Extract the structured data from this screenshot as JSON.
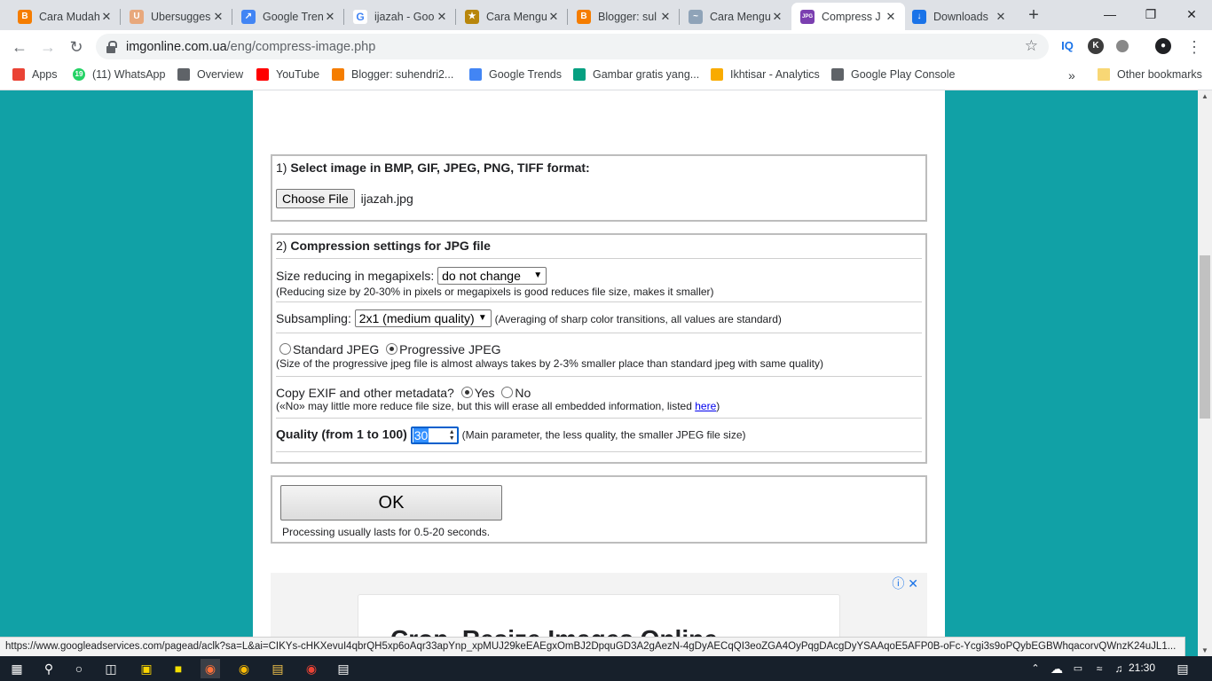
{
  "browser": {
    "tabs": [
      {
        "title": "Cara Mudah",
        "fav_color": "#f57d00",
        "fav_glyph": "B"
      },
      {
        "title": "Ubersugges",
        "fav_color": "#e8a87c",
        "fav_glyph": "U"
      },
      {
        "title": "Google Tren",
        "fav_color": "#4285f4",
        "fav_glyph": "↗"
      },
      {
        "title": "ijazah - Goo",
        "fav_color": "#ffffff",
        "fav_glyph": "G"
      },
      {
        "title": "Cara Mengu",
        "fav_color": "#b8860b",
        "fav_glyph": "★"
      },
      {
        "title": "Blogger: sul",
        "fav_color": "#f57d00",
        "fav_glyph": "B"
      },
      {
        "title": "Cara Mengu",
        "fav_color": "#8fa3b8",
        "fav_glyph": "~"
      },
      {
        "title": "Compress J",
        "fav_color": "#7b3fb0",
        "fav_glyph": "JPG",
        "active": true
      },
      {
        "title": "Downloads",
        "fav_color": "#1a73e8",
        "fav_glyph": "↓"
      }
    ],
    "url_domain": "imgonline.com.ua",
    "url_path": "/eng/compress-image.php",
    "bookmarks": [
      {
        "label": "Apps",
        "color": "#ea4335"
      },
      {
        "label": "(11) WhatsApp",
        "color": "#25d366",
        "glyph": "19"
      },
      {
        "label": "Overview",
        "color": "#5f6368"
      },
      {
        "label": "YouTube",
        "color": "#ff0000"
      },
      {
        "label": "Blogger: suhendri2...",
        "color": "#f57d00"
      },
      {
        "label": "Google Trends",
        "color": "#4285f4"
      },
      {
        "label": "Gambar gratis yang...",
        "color": "#05a081"
      },
      {
        "label": "Ikhtisar - Analytics",
        "color": "#f9ab00"
      },
      {
        "label": "Google Play Console",
        "color": "#5f6368"
      }
    ],
    "more_bookmarks": "»",
    "other_bookmarks": "Other bookmarks"
  },
  "form": {
    "section1": {
      "num": "1)",
      "title": "Select image in BMP, GIF, JPEG, PNG, TIFF format:",
      "choose_btn": "Choose File",
      "file_name": "ijazah.jpg"
    },
    "section2": {
      "num": "2)",
      "title": "Compression settings for JPG file",
      "size_label": "Size reducing in megapixels:",
      "size_value": "do not change",
      "size_note": "(Reducing size by 20-30% in pixels or megapixels is good reduces file size, makes it smaller)",
      "subsampling_label": "Subsampling:",
      "subsampling_value": "2x1 (medium quality)",
      "subsampling_note": "(Averaging of sharp color transitions, all values are standard)",
      "standard_jpeg": "Standard JPEG",
      "progressive_jpeg": "Progressive JPEG",
      "jpeg_note": "(Size of the progressive jpeg file is almost always takes by 2-3% smaller place than standard jpeg with same quality)",
      "exif_label": "Copy EXIF and other metadata?",
      "exif_yes": "Yes",
      "exif_no": "No",
      "exif_note_a": "(«No» may little more reduce file size, but this will erase all embedded information, listed ",
      "exif_note_link": "here",
      "exif_note_b": ")",
      "quality_label": "Quality (from 1 to 100)",
      "quality_value": "30",
      "quality_note": "(Main parameter, the less quality, the smaller JPEG file size)"
    },
    "ok_button": "OK",
    "ok_note": "Processing usually lasts for 0.5-20 seconds."
  },
  "ad": {
    "title": "Crop, Resize Images Online"
  },
  "status_url": "https://www.googleadservices.com/pagead/aclk?sa=L&ai=CIKYs-cHKXevuI4qbrQH5xp6oAqr33apYnp_xpMUJ29keEAEgxOmBJ2DpquGD3A2gAezN-4gDyAECqQI3eoZGA4OyPqgDAcgDyYSAAqoE5AFP0B-oFc-Ycgi3s9oPQybEGBWhqacorvQWnzK24uJL1...",
  "taskbar": {
    "time": "21:30"
  }
}
